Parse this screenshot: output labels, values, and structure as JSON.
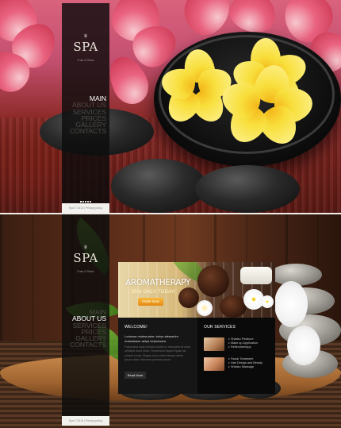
{
  "brand": {
    "logo": "SPA",
    "slogan": "Fuse & Relax"
  },
  "nav": {
    "items": [
      "MAIN",
      "ABOUT US",
      "SERVICES",
      "PRICES",
      "GALLERY",
      "CONTACTS"
    ]
  },
  "footer": "Spa © 2013 | Privacy policy",
  "top_nav_active": "MAIN",
  "bottom_nav_active": "ABOUT US",
  "banner": {
    "title": "AROMATHERAPY",
    "subtitle": "35% ONLY TODAY!",
    "cta": "Order Now"
  },
  "welcome": {
    "title": "WELCOME!",
    "lead": "Lortussa molesruaire; tortys afsesedm mdasdsase aetya ketyuesara",
    "body": "Fsdouutua lopia etrdeta bundel or rotnuseta sit amet cetrdeta dolor mida. Fermentum faquet ligula nsi, mdasd a erat. Magna luel a deta etisuna orlem ipsum dolor elements pulvinar ipsum.",
    "cta": "Read More"
  },
  "services": {
    "title": "OUR SERVICES",
    "groups": [
      [
        "Shiatsu Pedicure",
        "Make up Application",
        "Reflexotherapy"
      ],
      [
        "Facial Treatment",
        "Hair Design and Beauty",
        "Shiatsu Massage"
      ]
    ]
  },
  "colors": {
    "accent": "#f39c1e",
    "sidebar": "#0c0c0c",
    "nav_inactive": "#4f4b46",
    "nav_active": "#ffffff"
  }
}
